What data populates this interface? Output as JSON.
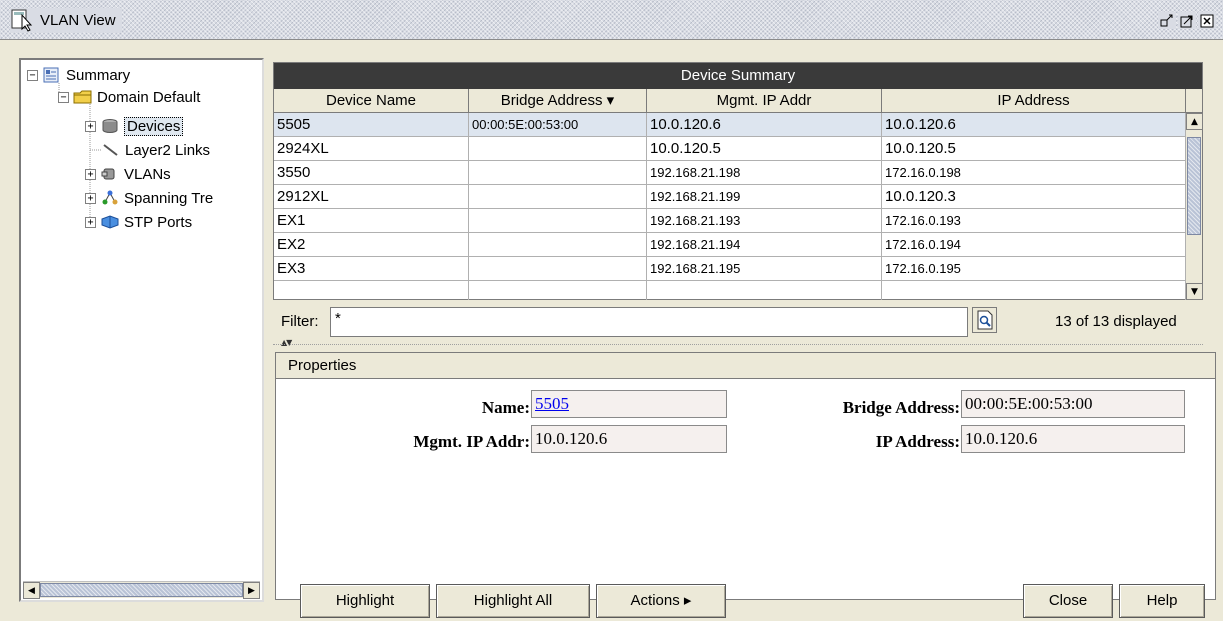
{
  "window": {
    "title": "VLAN View"
  },
  "tree": {
    "root": "Summary",
    "domain": "Domain Default",
    "items": [
      {
        "label": "Devices",
        "selected": true,
        "icon": "database-icon"
      },
      {
        "label": "Layer2 Links",
        "selected": false,
        "icon": "link-icon"
      },
      {
        "label": "VLANs",
        "selected": false,
        "icon": "vlan-icon"
      },
      {
        "label": "Spanning Tre",
        "selected": false,
        "icon": "spanning-tree-icon"
      },
      {
        "label": "STP Ports",
        "selected": false,
        "icon": "stp-ports-icon"
      }
    ]
  },
  "device_summary": {
    "title": "Device Summary",
    "columns": [
      "Device Name",
      "Bridge Address ▾",
      "Mgmt. IP Addr",
      "IP Address"
    ],
    "rows": [
      {
        "name": "5505",
        "bridge": "00:00:5E:00:53:00",
        "mgmt": "10.0.120.6",
        "ip": "10.0.120.6"
      },
      {
        "name": "2924XL",
        "bridge": "",
        "mgmt": "10.0.120.5",
        "ip": "10.0.120.5"
      },
      {
        "name": "3550",
        "bridge": "",
        "mgmt": "192.168.21.198",
        "ip": "172.16.0.198"
      },
      {
        "name": "2912XL",
        "bridge": "",
        "mgmt": "192.168.21.199",
        "ip": "10.0.120.3"
      },
      {
        "name": "EX1",
        "bridge": "",
        "mgmt": "192.168.21.193",
        "ip": "172.16.0.193"
      },
      {
        "name": "EX2",
        "bridge": "",
        "mgmt": "192.168.21.194",
        "ip": "172.16.0.194"
      },
      {
        "name": "EX3",
        "bridge": "",
        "mgmt": "192.168.21.195",
        "ip": "172.16.0.195"
      }
    ]
  },
  "filter": {
    "label": "Filter:",
    "value": "*",
    "count_text": "13 of 13 displayed"
  },
  "properties": {
    "header": "Properties",
    "name_label": "Name:",
    "name_value": "5505",
    "mgmt_label": "Mgmt. IP Addr:",
    "mgmt_value": "10.0.120.6",
    "bridge_label": "Bridge Address:",
    "bridge_value": "00:00:5E:00:53:00",
    "ip_label": "IP Address:",
    "ip_value": "10.0.120.6"
  },
  "buttons": {
    "highlight": "Highlight",
    "highlight_all": "Highlight All",
    "actions": "Actions ▸",
    "close": "Close",
    "help": "Help"
  },
  "colors": {
    "table_title_bg": "#3a3a3a",
    "selection_bg": "#dde5ef",
    "window_bg": "#ece9d8"
  }
}
